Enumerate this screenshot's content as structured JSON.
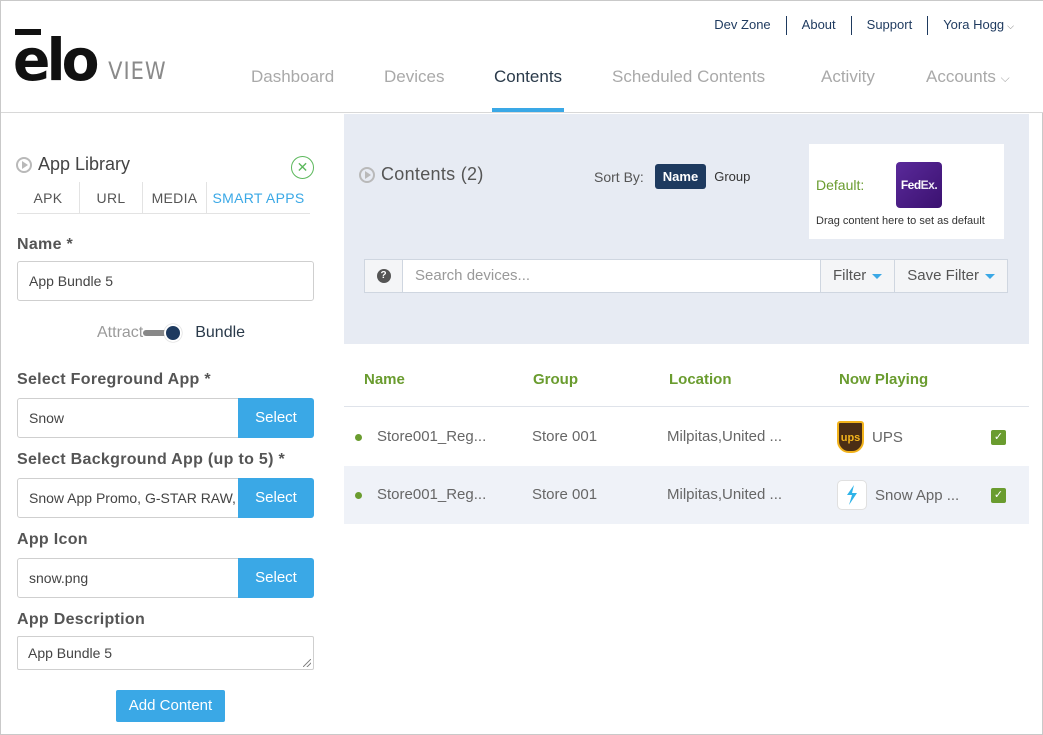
{
  "brand": {
    "logo_primary": "elo",
    "logo_secondary": "VIEW"
  },
  "top_links": [
    "Dev Zone",
    "About",
    "Support"
  ],
  "user": {
    "name": "Yora Hogg"
  },
  "nav": {
    "dashboard": "Dashboard",
    "devices": "Devices",
    "contents": "Contents",
    "scheduled": "Scheduled Contents",
    "activity": "Activity",
    "accounts": "Accounts",
    "active": "Contents"
  },
  "sidebar": {
    "title": "App Library",
    "tabs": [
      "APK",
      "URL",
      "MEDIA",
      "SMART APPS"
    ],
    "active_tab": "SMART APPS",
    "name_label": "Name *",
    "name_value": "App Bundle 5",
    "toggle_off_label": "Attract",
    "toggle_on_label": "Bundle",
    "toggle_state": "Bundle",
    "fg_label": "Select Foreground App *",
    "fg_value": "Snow",
    "bg_label": "Select Background App (up to 5) *",
    "bg_value": "Snow App Promo, G-STAR RAW, N",
    "icon_label": "App Icon",
    "icon_value": "snow.png",
    "select_label": "Select",
    "desc_label": "App Description",
    "desc_value": "App Bundle 5",
    "add_label": "Add Content"
  },
  "contents": {
    "title": "Contents (2)",
    "sort_label": "Sort By:",
    "sort_options": [
      "Name",
      "Group"
    ],
    "sort_active": "Name",
    "default_label": "Default:",
    "default_logo_fed": "Fed",
    "default_logo_ex": "Ex.",
    "default_hint": "Drag content here to set as default",
    "search_placeholder": "Search devices...",
    "filter_label": "Filter",
    "save_filter_label": "Save Filter",
    "columns": [
      "Name",
      "Group",
      "Location",
      "Now Playing"
    ],
    "rows": [
      {
        "name": "Store001_Reg...",
        "group": "Store 001",
        "location": "Milpitas,United ...",
        "now_playing": "UPS",
        "icon": "ups-logo-icon",
        "checked": true
      },
      {
        "name": "Store001_Reg...",
        "group": "Store 001",
        "location": "Milpitas,United ...",
        "now_playing": "Snow App ...",
        "icon": "snow-app-icon",
        "checked": true
      }
    ],
    "ups_icon_text": "ups"
  },
  "colors": {
    "accent_blue": "#3aa8e6",
    "navy": "#1e3a5f",
    "green": "#6a9c2f",
    "panel_bg": "#e7ebf3"
  }
}
